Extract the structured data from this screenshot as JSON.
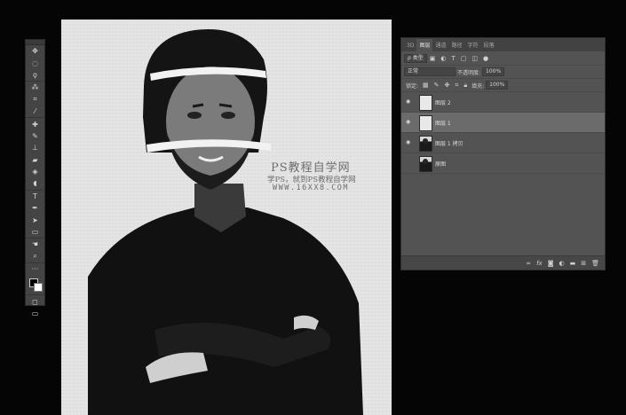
{
  "tools": [
    {
      "name": "move-tool-icon",
      "glyph": "✥"
    },
    {
      "name": "marquee-tool-icon",
      "glyph": "◌"
    },
    {
      "name": "lasso-tool-icon",
      "glyph": "ϙ"
    },
    {
      "name": "magic-wand-tool-icon",
      "glyph": "⁂"
    },
    {
      "name": "crop-tool-icon",
      "glyph": "⌗"
    },
    {
      "name": "eyedropper-tool-icon",
      "glyph": "⁄"
    },
    {
      "name": "healing-brush-tool-icon",
      "glyph": "✚"
    },
    {
      "name": "brush-tool-icon",
      "glyph": "✎"
    },
    {
      "name": "clone-stamp-tool-icon",
      "glyph": "⊥"
    },
    {
      "name": "eraser-tool-icon",
      "glyph": "▰"
    },
    {
      "name": "paint-bucket-tool-icon",
      "glyph": "◈"
    },
    {
      "name": "dodge-tool-icon",
      "glyph": "◖"
    },
    {
      "name": "type-tool-icon",
      "glyph": "T"
    },
    {
      "name": "pen-tool-icon",
      "glyph": "✒"
    },
    {
      "name": "path-selection-tool-icon",
      "glyph": "➤"
    },
    {
      "name": "rectangle-tool-icon",
      "glyph": "▭"
    },
    {
      "name": "hand-tool-icon",
      "glyph": "☚"
    },
    {
      "name": "zoom-tool-icon",
      "glyph": "⌕"
    },
    {
      "name": "more-tools-icon",
      "glyph": "···"
    }
  ],
  "watermark": {
    "line1": "PS教程自学网",
    "line2": "学PS，就到PS教程自学网",
    "line3": "WWW.16XX8.COM"
  },
  "layers_panel": {
    "tabs": [
      "3D",
      "图层",
      "通道",
      "路径",
      "字符",
      "段落"
    ],
    "active_tab": 1,
    "filter_kind": "ρ 类型",
    "blend_mode": "正常",
    "opacity_label": "不透明度:",
    "opacity_value": "100%",
    "lock_label": "锁定:",
    "fill_label": "填充:",
    "fill_value": "100%",
    "layers": [
      {
        "name": "图层 2",
        "thumb": "blank",
        "visible": true,
        "selected": false
      },
      {
        "name": "图层 1",
        "thumb": "blank",
        "visible": true,
        "selected": true
      },
      {
        "name": "图层 1 拷贝",
        "thumb": "photo",
        "visible": true,
        "selected": false
      },
      {
        "name": "原图",
        "thumb": "photo",
        "visible": false,
        "selected": false
      }
    ],
    "footer_icons": [
      "link-layers-icon",
      "fx-icon",
      "layer-mask-icon",
      "adjustment-layer-icon",
      "group-icon",
      "new-layer-icon",
      "trash-icon"
    ]
  },
  "colors": {
    "background": "#050505",
    "panel": "#535353",
    "selected_layer": "#6b6b6b",
    "canvas": "#e4e4e4"
  }
}
